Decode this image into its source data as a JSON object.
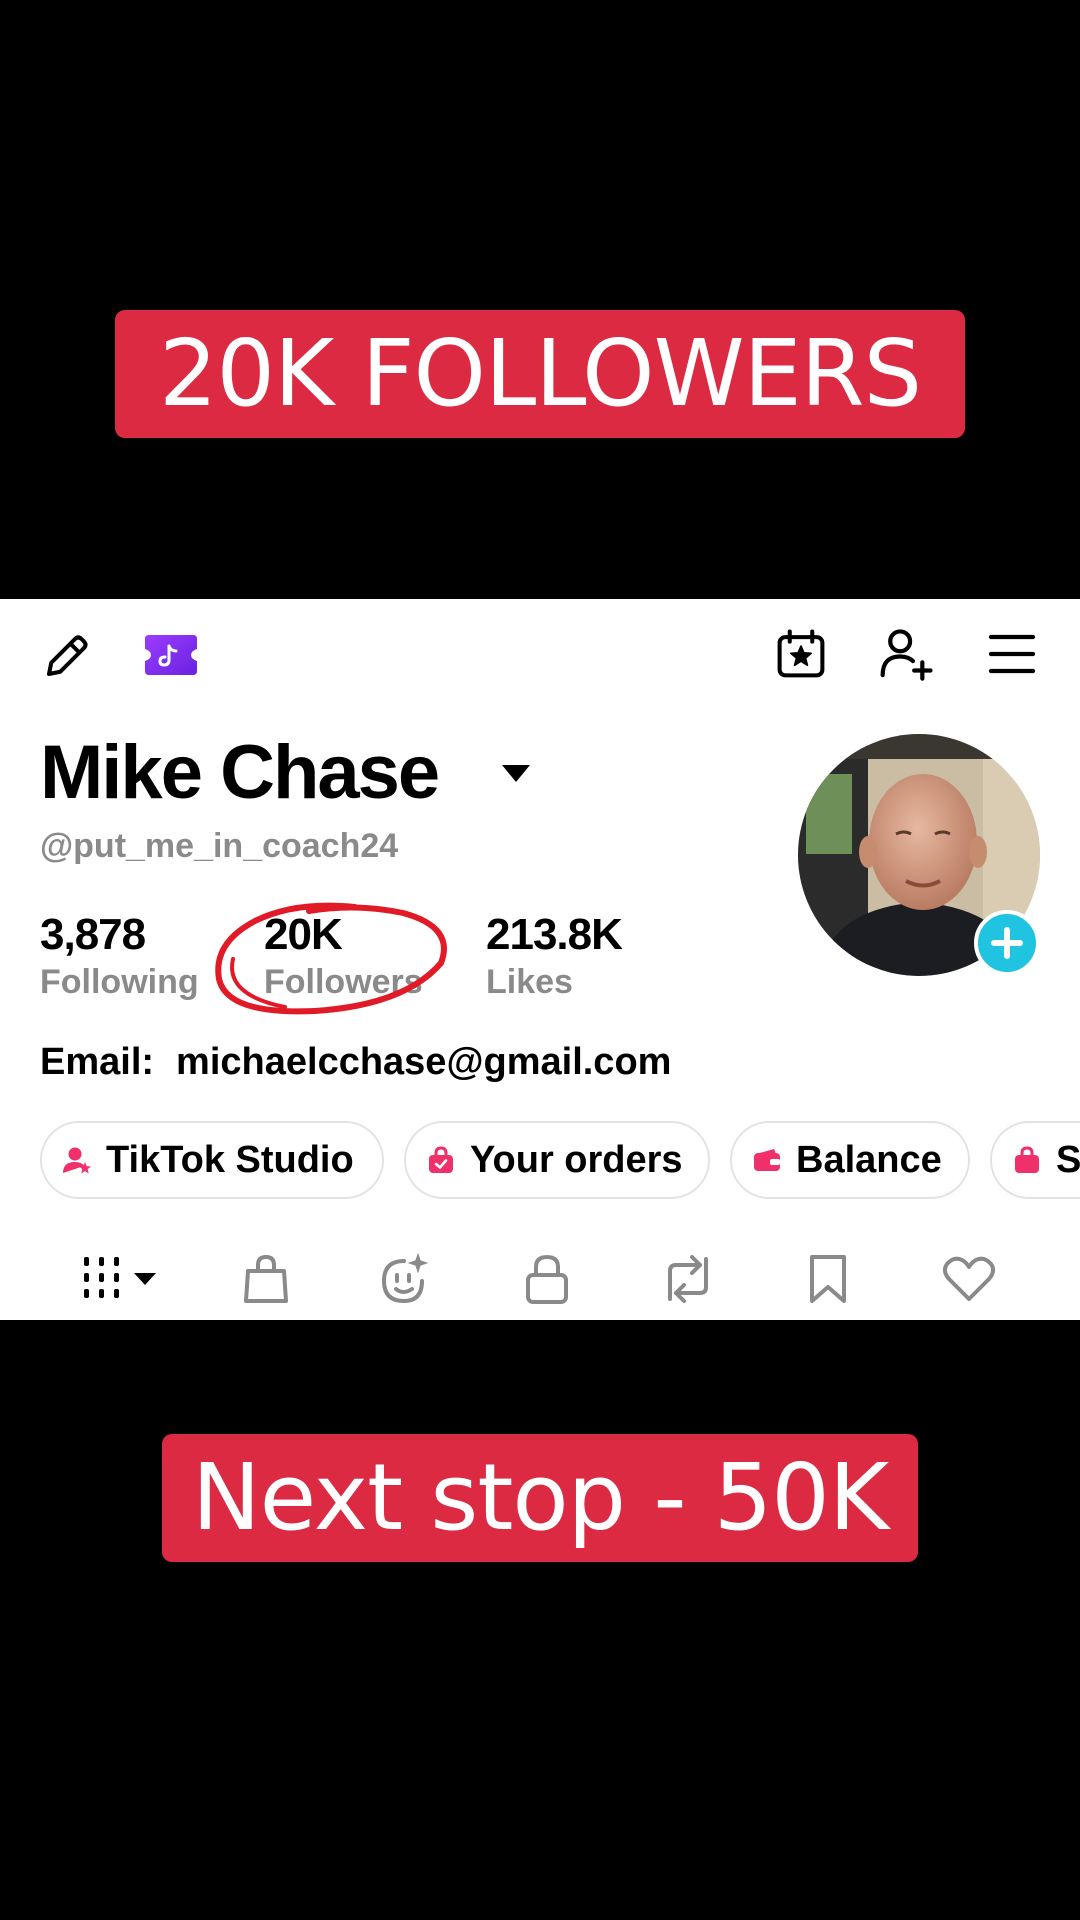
{
  "overlay": {
    "top_caption": "20K FOLLOWERS",
    "bottom_caption": "Next stop - 50K"
  },
  "header": {
    "icons": [
      "edit-pencil-icon",
      "tiktok-ticket-icon",
      "calendar-star-icon",
      "add-friend-icon",
      "menu-icon"
    ]
  },
  "profile": {
    "name": "Mike Chase",
    "handle": "@put_me_in_coach24",
    "stats": [
      {
        "value": "3,878",
        "label": "Following"
      },
      {
        "value": "20K",
        "label": "Followers"
      },
      {
        "value": "213.8K",
        "label": "Likes"
      }
    ],
    "email_label": "Email:",
    "email_value": "michaelcchase@gmail.com"
  },
  "shortcuts": [
    {
      "label": "TikTok Studio",
      "icon": "studio-user-icon"
    },
    {
      "label": "Your orders",
      "icon": "orders-bag-icon"
    },
    {
      "label": "Balance",
      "icon": "wallet-icon"
    },
    {
      "label": "S",
      "icon": "shop-bag-icon"
    }
  ],
  "tabs": [
    "videos-grid-icon",
    "shop-bag-icon",
    "ai-self-icon",
    "private-lock-icon",
    "repost-icon",
    "bookmark-icon",
    "liked-heart-icon"
  ],
  "colors": {
    "banner_red": "#dc2a42",
    "annotation_red": "#e01a26",
    "secondary_text": "#8a8a8a",
    "add_badge": "#20c4e0",
    "tiktok_purple": "#7a2cf0",
    "shortcut_pink": "#f0306a"
  }
}
